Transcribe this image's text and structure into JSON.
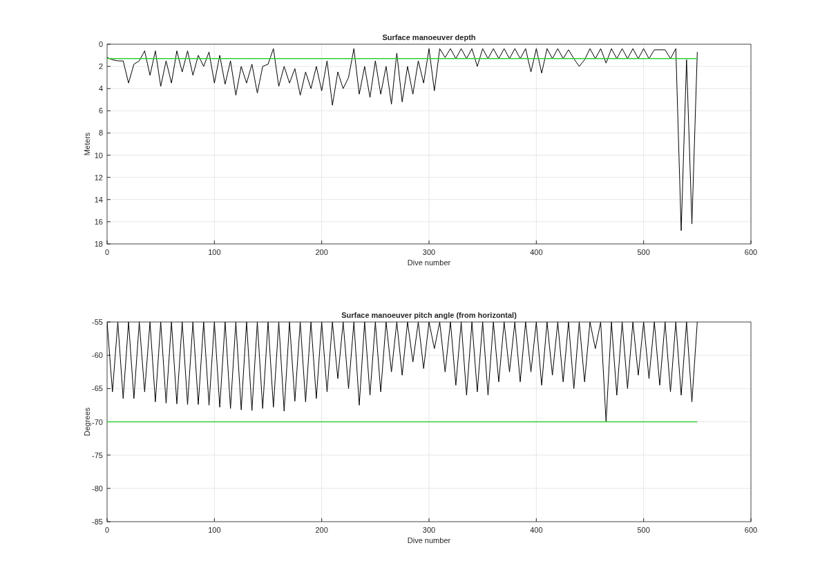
{
  "figure": {
    "charts": [
      {
        "chart_data": {
          "type": "line",
          "title": "Surface manoeuver depth",
          "xlabel": "Dive number",
          "ylabel": "Meters",
          "xlim": [
            0,
            600
          ],
          "ylim": [
            18,
            0
          ],
          "xticks": [
            0,
            100,
            200,
            300,
            400,
            500,
            600
          ],
          "yticks": [
            0,
            2,
            4,
            6,
            8,
            10,
            12,
            14,
            16,
            18
          ],
          "grid": true,
          "x": [
            0,
            5,
            10,
            15,
            20,
            25,
            30,
            35,
            40,
            45,
            50,
            55,
            60,
            65,
            70,
            75,
            80,
            85,
            90,
            95,
            100,
            105,
            110,
            115,
            120,
            125,
            130,
            135,
            140,
            145,
            150,
            155,
            160,
            165,
            170,
            175,
            180,
            185,
            190,
            195,
            200,
            205,
            210,
            215,
            220,
            225,
            230,
            235,
            240,
            245,
            250,
            255,
            260,
            265,
            270,
            275,
            280,
            285,
            290,
            295,
            300,
            305,
            310,
            315,
            320,
            325,
            330,
            335,
            340,
            345,
            350,
            355,
            360,
            365,
            370,
            375,
            380,
            385,
            390,
            395,
            400,
            405,
            410,
            415,
            420,
            425,
            430,
            435,
            440,
            445,
            450,
            455,
            460,
            465,
            470,
            475,
            480,
            485,
            490,
            495,
            500,
            505,
            510,
            515,
            520,
            525,
            530,
            535,
            540,
            545,
            550
          ],
          "series": [
            {
              "color": "#000000",
              "values": [
                1.2,
                1.4,
                1.5,
                1.5,
                3.5,
                1.8,
                1.5,
                0.6,
                2.8,
                0.6,
                3.8,
                1.5,
                3.5,
                0.6,
                2.5,
                0.6,
                2.8,
                1.0,
                2.0,
                0.7,
                3.5,
                1.0,
                3.6,
                1.5,
                4.6,
                2.0,
                3.5,
                1.8,
                4.4,
                2.0,
                1.8,
                0.4,
                3.8,
                2.0,
                3.5,
                2.2,
                4.6,
                2.5,
                4.0,
                2.0,
                4.2,
                1.5,
                5.5,
                2.5,
                4.0,
                3.0,
                0.4,
                4.5,
                2.0,
                4.8,
                1.5,
                4.5,
                2.0,
                5.4,
                0.8,
                5.2,
                2.0,
                4.5,
                1.5,
                3.5,
                0.4,
                4.2,
                0.4,
                1.2,
                0.4,
                1.3,
                0.4,
                1.3,
                0.4,
                2.0,
                0.4,
                1.3,
                0.4,
                1.3,
                0.4,
                1.3,
                0.4,
                1.3,
                0.4,
                2.5,
                0.4,
                2.6,
                0.4,
                1.3,
                0.4,
                1.3,
                0.5,
                1.3,
                2.0,
                1.4,
                0.4,
                1.3,
                0.4,
                1.7,
                0.4,
                1.3,
                0.4,
                1.3,
                0.4,
                1.3,
                0.4,
                1.3,
                0.5,
                0.5,
                0.5,
                1.3,
                0.4,
                16.8,
                1.4,
                16.2,
                0.7
              ]
            },
            {
              "color": "#33cc33",
              "values": [
                1.3,
                1.3,
                1.3,
                1.3,
                1.3,
                1.3,
                1.3,
                1.3,
                1.3,
                1.3,
                1.3,
                1.3,
                1.3,
                1.3,
                1.3,
                1.3,
                1.3,
                1.3,
                1.3,
                1.3,
                1.3,
                1.3,
                1.3,
                1.3,
                1.3,
                1.3,
                1.3,
                1.3,
                1.3,
                1.3,
                1.3,
                1.3,
                1.3,
                1.3,
                1.3,
                1.3,
                1.3,
                1.3,
                1.3,
                1.3,
                1.3,
                1.3,
                1.3,
                1.3,
                1.3,
                1.3,
                1.3,
                1.3,
                1.3,
                1.3,
                1.3,
                1.3,
                1.3,
                1.3,
                1.3,
                1.3,
                1.3,
                1.3,
                1.3,
                1.3,
                1.3,
                1.3,
                1.3,
                1.3,
                1.3,
                1.3,
                1.3,
                1.3,
                1.3,
                1.3,
                1.3,
                1.3,
                1.3,
                1.3,
                1.3,
                1.3,
                1.3,
                1.3,
                1.3,
                1.3,
                1.3,
                1.3,
                1.3,
                1.3,
                1.3,
                1.3,
                1.3,
                1.3,
                1.3,
                1.3,
                1.3,
                1.3,
                1.3,
                1.3,
                1.3,
                1.3,
                1.3,
                1.3,
                1.3,
                1.3,
                1.3,
                1.3,
                1.3,
                1.3,
                1.3,
                1.3,
                1.3,
                1.3,
                1.3,
                1.3,
                1.3
              ]
            }
          ]
        }
      },
      {
        "chart_data": {
          "type": "line",
          "title": "Surface manoeuver pitch angle (from horizontal)",
          "xlabel": "Dive number",
          "ylabel": "Degrees",
          "xlim": [
            0,
            600
          ],
          "ylim": [
            -85,
            -55
          ],
          "xticks": [
            0,
            100,
            200,
            300,
            400,
            500,
            600
          ],
          "yticks": [
            -85,
            -80,
            -75,
            -70,
            -65,
            -60,
            -55
          ],
          "grid": true,
          "x": [
            0,
            5,
            10,
            15,
            20,
            25,
            30,
            35,
            40,
            45,
            50,
            55,
            60,
            65,
            70,
            75,
            80,
            85,
            90,
            95,
            100,
            105,
            110,
            115,
            120,
            125,
            130,
            135,
            140,
            145,
            150,
            155,
            160,
            165,
            170,
            175,
            180,
            185,
            190,
            195,
            200,
            205,
            210,
            215,
            220,
            225,
            230,
            235,
            240,
            245,
            250,
            255,
            260,
            265,
            270,
            275,
            280,
            285,
            290,
            295,
            300,
            305,
            310,
            315,
            320,
            325,
            330,
            335,
            340,
            345,
            350,
            355,
            360,
            365,
            370,
            375,
            380,
            385,
            390,
            395,
            400,
            405,
            410,
            415,
            420,
            425,
            430,
            435,
            440,
            445,
            450,
            455,
            460,
            465,
            470,
            475,
            480,
            485,
            490,
            495,
            500,
            505,
            510,
            515,
            520,
            525,
            530,
            535,
            540,
            545,
            550
          ],
          "series": [
            {
              "color": "#000000",
              "values": [
                -55,
                -65.5,
                -55,
                -66.5,
                -55,
                -66.5,
                -55,
                -65.5,
                -55,
                -67,
                -55,
                -67.2,
                -55,
                -67.3,
                -55,
                -67.4,
                -55,
                -67.4,
                -55,
                -67.5,
                -55,
                -67.8,
                -55,
                -68,
                -55,
                -68.2,
                -55,
                -68.3,
                -55,
                -68,
                -55,
                -67.8,
                -55,
                -68.4,
                -55,
                -66.9,
                -55,
                -67,
                -55,
                -66.5,
                -55,
                -65.5,
                -55,
                -63.5,
                -55,
                -65,
                -55,
                -67.5,
                -55,
                -66,
                -55,
                -65.5,
                -55,
                -62.5,
                -55,
                -63,
                -55,
                -61,
                -55,
                -62,
                -55,
                -59,
                -55,
                -62.5,
                -55,
                -64.5,
                -55,
                -66,
                -55,
                -65.5,
                -55,
                -66,
                -55,
                -64,
                -55,
                -62.5,
                -55,
                -64,
                -55,
                -62.5,
                -55,
                -64.5,
                -55,
                -63,
                -55,
                -64,
                -55,
                -65,
                -55,
                -64,
                -55,
                -59,
                -55,
                -70,
                -55,
                -66,
                -55,
                -65,
                -55,
                -63,
                -55,
                -63.5,
                -55,
                -64.5,
                -55,
                -65.5,
                -55,
                -66,
                -55,
                -67,
                -55
              ]
            },
            {
              "color": "#33cc33",
              "values": [
                -70,
                -70,
                -70,
                -70,
                -70,
                -70,
                -70,
                -70,
                -70,
                -70,
                -70,
                -70,
                -70,
                -70,
                -70,
                -70,
                -70,
                -70,
                -70,
                -70,
                -70,
                -70,
                -70,
                -70,
                -70,
                -70,
                -70,
                -70,
                -70,
                -70,
                -70,
                -70,
                -70,
                -70,
                -70,
                -70,
                -70,
                -70,
                -70,
                -70,
                -70,
                -70,
                -70,
                -70,
                -70,
                -70,
                -70,
                -70,
                -70,
                -70,
                -70,
                -70,
                -70,
                -70,
                -70,
                -70,
                -70,
                -70,
                -70,
                -70,
                -70,
                -70,
                -70,
                -70,
                -70,
                -70,
                -70,
                -70,
                -70,
                -70,
                -70,
                -70,
                -70,
                -70,
                -70,
                -70,
                -70,
                -70,
                -70,
                -70,
                -70,
                -70,
                -70,
                -70,
                -70,
                -70,
                -70,
                -70,
                -70,
                -70,
                -70,
                -70,
                -70,
                -70,
                -70,
                -70,
                -70,
                -70,
                -70,
                -70,
                -70,
                -70,
                -70,
                -70,
                -70,
                -70,
                -70,
                -70,
                -70,
                -70,
                -70
              ]
            }
          ]
        }
      }
    ]
  }
}
